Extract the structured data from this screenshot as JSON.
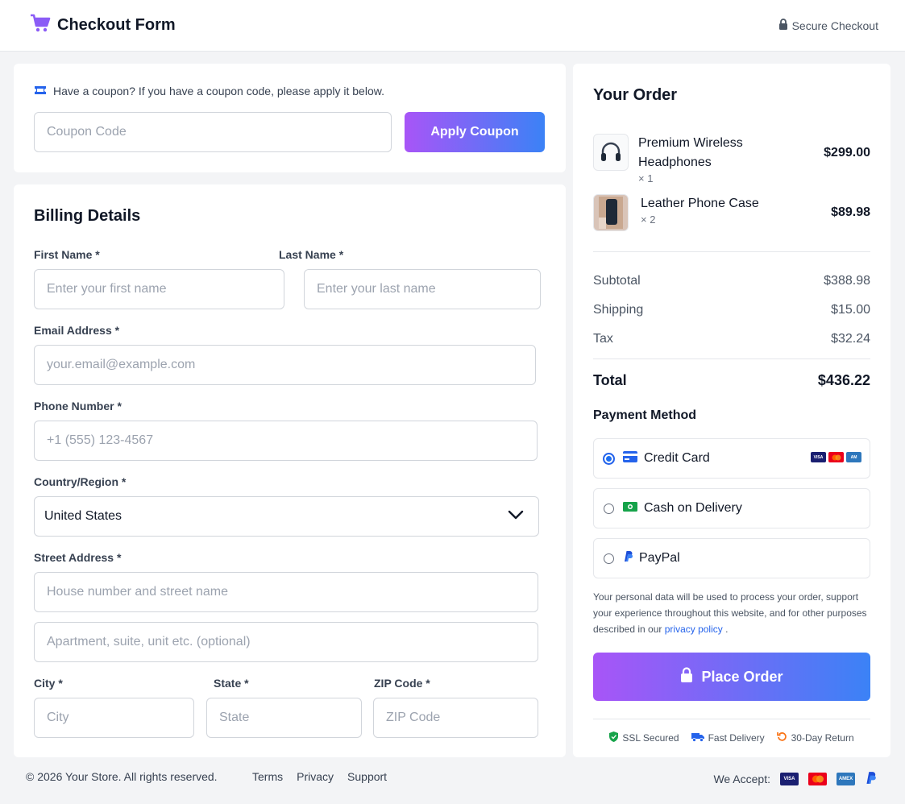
{
  "header": {
    "title": "Checkout Form",
    "secure_text": "Secure Checkout"
  },
  "coupon": {
    "message": "Have a coupon? If you have a coupon code, please apply it below.",
    "placeholder": "Coupon Code",
    "button": "Apply Coupon"
  },
  "billing": {
    "title": "Billing Details",
    "first_name": {
      "label": "First Name *",
      "placeholder": "Enter your first name"
    },
    "last_name": {
      "label": "Last Name *",
      "placeholder": "Enter your last name"
    },
    "email": {
      "label": "Email Address *",
      "placeholder": "your.email@example.com"
    },
    "phone": {
      "label": "Phone Number *",
      "placeholder": "+1 (555) 123-4567"
    },
    "country": {
      "label": "Country/Region *",
      "value": "United States"
    },
    "street": {
      "label": "Street Address *",
      "placeholder": "House number and street name",
      "placeholder2": "Apartment, suite, unit etc. (optional)"
    },
    "city": {
      "label": "City *",
      "placeholder": "City"
    },
    "state": {
      "label": "State *",
      "placeholder": "State"
    },
    "zip": {
      "label": "ZIP Code *",
      "placeholder": "ZIP Code"
    }
  },
  "order": {
    "title": "Your Order",
    "items": [
      {
        "name_line1": "Premium Wireless",
        "name_line2": "Headphones",
        "qty": "× 1",
        "price": "$299.00"
      },
      {
        "name": "Leather Phone Case",
        "qty": "× 2",
        "price": "$89.98"
      }
    ],
    "subtotal": {
      "label": "Subtotal",
      "value": "$388.98"
    },
    "shipping": {
      "label": "Shipping",
      "value": "$15.00"
    },
    "tax": {
      "label": "Tax",
      "value": "$32.24"
    },
    "total": {
      "label": "Total",
      "value": "$436.22"
    },
    "payment_title": "Payment Method",
    "payment_options": [
      {
        "label": "Credit Card",
        "selected": true
      },
      {
        "label": "Cash on Delivery",
        "selected": false
      },
      {
        "label": "PayPal",
        "selected": false
      }
    ],
    "privacy_text": "Your personal data will be used to process your order, support your experience throughout this website, and for other purposes described in our",
    "privacy_link": "privacy policy",
    "privacy_end": ".",
    "place_order": "Place Order",
    "badges": [
      "SSL Secured",
      "Fast Delivery",
      "30-Day Return"
    ]
  },
  "footer": {
    "copyright": "© 2026 Your Store. All rights reserved.",
    "links": [
      "Terms",
      "Privacy",
      "Support"
    ],
    "accept_label": "We Accept:"
  },
  "colors": {
    "accent_start": "#a855f7",
    "accent_end": "#3b82f6",
    "link": "#2563eb",
    "brand_icon": "#8b5cf6"
  },
  "icons": [
    "cart-icon",
    "lock-icon",
    "ticket-icon",
    "chevron-down-icon",
    "credit-card-icon",
    "cash-icon",
    "paypal-icon",
    "shield-icon",
    "truck-icon",
    "return-icon",
    "visa-icon",
    "mastercard-icon",
    "amex-icon"
  ]
}
